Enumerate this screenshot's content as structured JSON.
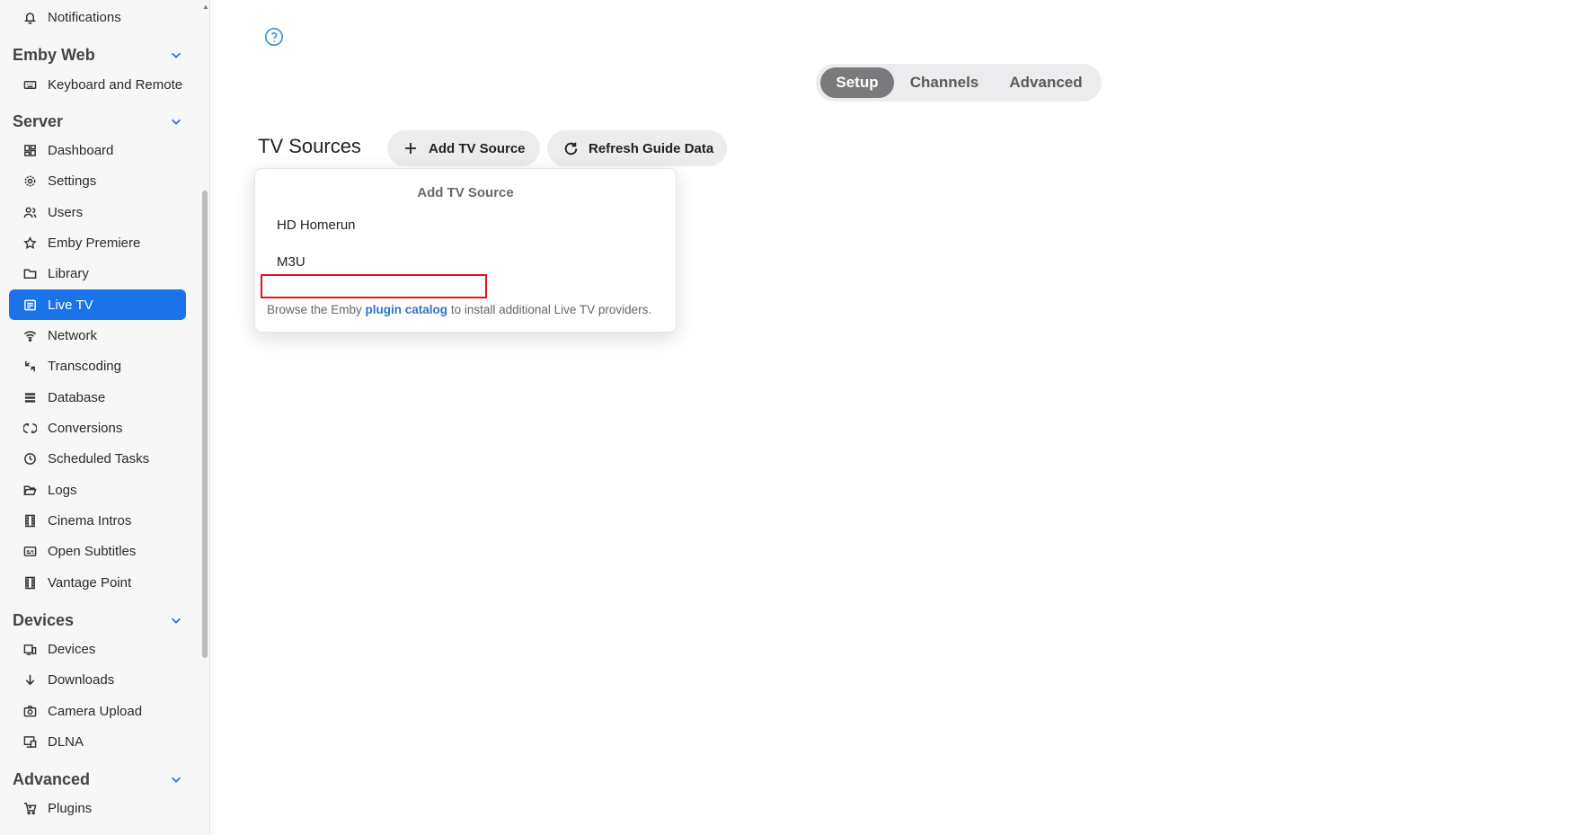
{
  "sidebar": {
    "top_item": {
      "label": "Notifications",
      "icon": "bell-icon"
    },
    "sections": [
      {
        "title": "Emby Web",
        "items": [
          {
            "label": "Keyboard and Remote",
            "icon": "keyboard-icon"
          }
        ]
      },
      {
        "title": "Server",
        "items": [
          {
            "label": "Dashboard",
            "icon": "dashboard-icon"
          },
          {
            "label": "Settings",
            "icon": "gear-icon"
          },
          {
            "label": "Users",
            "icon": "users-icon"
          },
          {
            "label": "Emby Premiere",
            "icon": "star-icon"
          },
          {
            "label": "Library",
            "icon": "folder-icon"
          },
          {
            "label": "Live TV",
            "icon": "tv-guide-icon",
            "active": true
          },
          {
            "label": "Network",
            "icon": "wifi-icon"
          },
          {
            "label": "Transcoding",
            "icon": "transcode-icon"
          },
          {
            "label": "Database",
            "icon": "database-icon"
          },
          {
            "label": "Conversions",
            "icon": "conversion-icon"
          },
          {
            "label": "Scheduled Tasks",
            "icon": "clock-icon"
          },
          {
            "label": "Logs",
            "icon": "folder-open-icon"
          },
          {
            "label": "Cinema Intros",
            "icon": "film-icon"
          },
          {
            "label": "Open Subtitles",
            "icon": "subtitles-icon"
          },
          {
            "label": "Vantage Point",
            "icon": "film-icon"
          }
        ]
      },
      {
        "title": "Devices",
        "items": [
          {
            "label": "Devices",
            "icon": "devices-icon"
          },
          {
            "label": "Downloads",
            "icon": "download-arrow-icon"
          },
          {
            "label": "Camera Upload",
            "icon": "camera-icon"
          },
          {
            "label": "DLNA",
            "icon": "dlna-icon"
          }
        ]
      },
      {
        "title": "Advanced",
        "items": [
          {
            "label": "Plugins",
            "icon": "cart-icon"
          }
        ]
      }
    ]
  },
  "tabs": {
    "setup": "Setup",
    "channels": "Channels",
    "advanced": "Advanced",
    "active": "Setup"
  },
  "main": {
    "heading": "TV Sources",
    "add_button": "Add TV Source",
    "refresh_button": "Refresh Guide Data"
  },
  "dropdown": {
    "title": "Add TV Source",
    "items": [
      "HD Homerun",
      "M3U"
    ],
    "footer_prefix": "Browse the Emby ",
    "footer_link": "plugin catalog",
    "footer_suffix": " to install additional Live TV providers."
  },
  "colors": {
    "accent": "#1a73e8",
    "link": "#2f73c9",
    "highlight": "#e3141b"
  }
}
